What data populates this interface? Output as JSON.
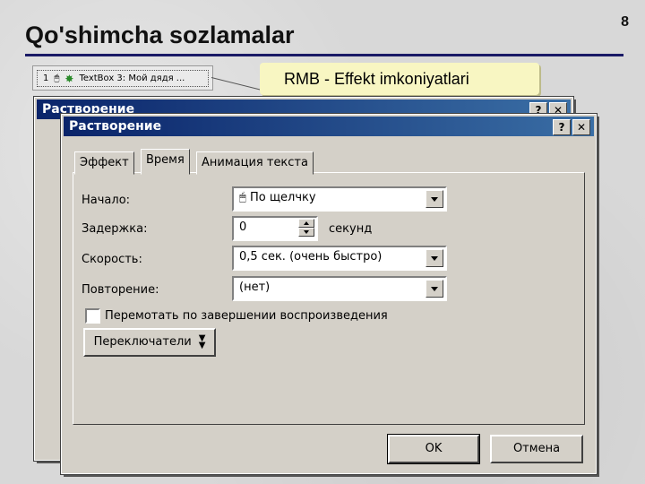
{
  "slide": {
    "title": "Qo'shimcha sozlamalar",
    "number": "8"
  },
  "anim_list": {
    "index": "1",
    "item": "TextBox 3: Мой дядя ..."
  },
  "callout": {
    "text": "RMB - Effekt imkoniyatlari"
  },
  "back_dialog": {
    "title": "Растворение",
    "help": "?",
    "close": "✕"
  },
  "dialog": {
    "title": "Растворение",
    "help": "?",
    "close": "✕",
    "tabs": [
      "Эффект",
      "Время",
      "Анимация текста"
    ],
    "active_tab": "Время",
    "fields": {
      "start_label": "Начало:",
      "start_value": "По щелчку",
      "delay_label": "Задержка:",
      "delay_value": "0",
      "delay_unit": "секунд",
      "speed_label": "Скорость:",
      "speed_value": "0,5 сек. (очень быстро)",
      "repeat_label": "Повторение:",
      "repeat_value": "(нет)"
    },
    "rewind_label": "Перемотать по завершении воспроизведения",
    "rewind_checked": false,
    "triggers_button": "Переключатели",
    "ok": "OK",
    "cancel": "Отмена"
  },
  "colors": {
    "titlebar": "#0a246a",
    "dialog_bg": "#d4d0c8",
    "callout_bg": "#f8f6c2",
    "title_rule": "#1a1a66"
  }
}
